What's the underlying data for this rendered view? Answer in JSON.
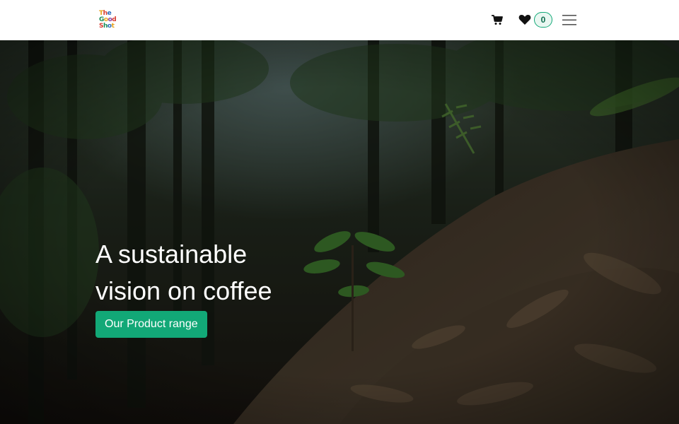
{
  "header": {
    "logo_lines": [
      "The",
      "Good",
      "Shot"
    ],
    "cart_icon": "shopping-cart-icon",
    "wishlist_icon": "heart-icon",
    "wishlist_count": "0",
    "menu_icon": "hamburger-menu-icon"
  },
  "hero": {
    "headline_line1": "A sustainable",
    "headline_line2": "vision on coffee",
    "cta_label": "Our Product range"
  },
  "colors": {
    "accent": "#12a877",
    "nav_bg": "#ffffff",
    "hero_overlay": "#1b2016"
  }
}
